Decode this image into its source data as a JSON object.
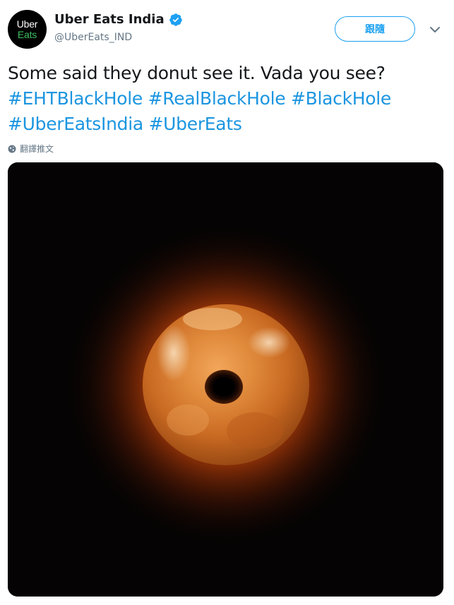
{
  "account": {
    "avatar_top": "Uber",
    "avatar_bottom": "Eats",
    "display_name": "Uber Eats India",
    "handle": "@UberEats_IND",
    "verified": true
  },
  "actions": {
    "follow_label": "跟隨"
  },
  "tweet": {
    "text": "Some said they donut see it. Vada you see?",
    "hashtags_line1": [
      "#EHTBlackHole",
      "#RealBlackHole",
      "#BlackHole"
    ],
    "hashtags_line2": [
      "#UberEatsIndia",
      "#UberEats"
    ]
  },
  "translate_label": "翻譯推文",
  "colors": {
    "accent": "#1da1f2",
    "hashtag": "#1b95e0",
    "secondary_text": "#657786",
    "verified": "#1da1f2",
    "logo_green": "#3fc060"
  },
  "media": {
    "description_icon": "donut-black-hole-image"
  }
}
